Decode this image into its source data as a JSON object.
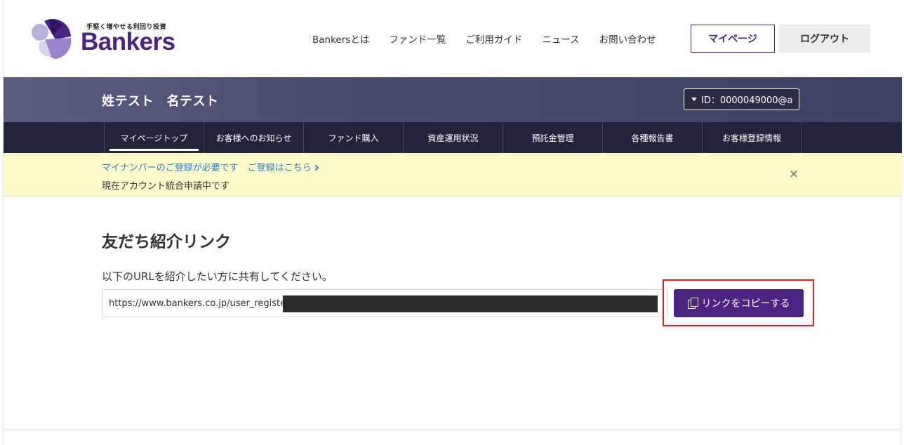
{
  "header": {
    "tagline": "手堅く増やせる利回り投資",
    "logo_text": "Bankers",
    "nav": [
      "Bankersとは",
      "ファンド一覧",
      "ご利用ガイド",
      "ニュース",
      "お問い合わせ"
    ],
    "mypage_label": "マイページ",
    "logout_label": "ログアウト"
  },
  "user": {
    "name": "姓テスト　名テスト",
    "id_label": "ID：0000049000@a"
  },
  "subnav": {
    "items": [
      "マイページトップ",
      "お客様へのお知らせ",
      "ファンド購入",
      "資産運用状況",
      "預託金管理",
      "各種報告書",
      "お客様登録情報"
    ],
    "active_index": 0
  },
  "notice": {
    "link_text": "マイナンバーのご登録が必要です　ご登録はこちら",
    "status_text": "現在アカウント統合申請中です",
    "close_glyph": "×"
  },
  "main": {
    "title": "友だち紹介リンク",
    "description": "以下のURLを紹介したい方に共有してください。",
    "url_value": "https://www.bankers.co.jp/user_register",
    "copy_button_label": "リンクをコピーする"
  },
  "colors": {
    "brand_purple": "#4a2383",
    "band_dark": "#22243a",
    "notice_bg": "#fdfbc9",
    "link_blue": "#2b7fd3",
    "highlight_red": "#e02020"
  },
  "icons": {
    "copy": "copy-icon",
    "caret": "caret-down-icon",
    "chevron": "chevron-right-icon",
    "close": "close-icon"
  }
}
